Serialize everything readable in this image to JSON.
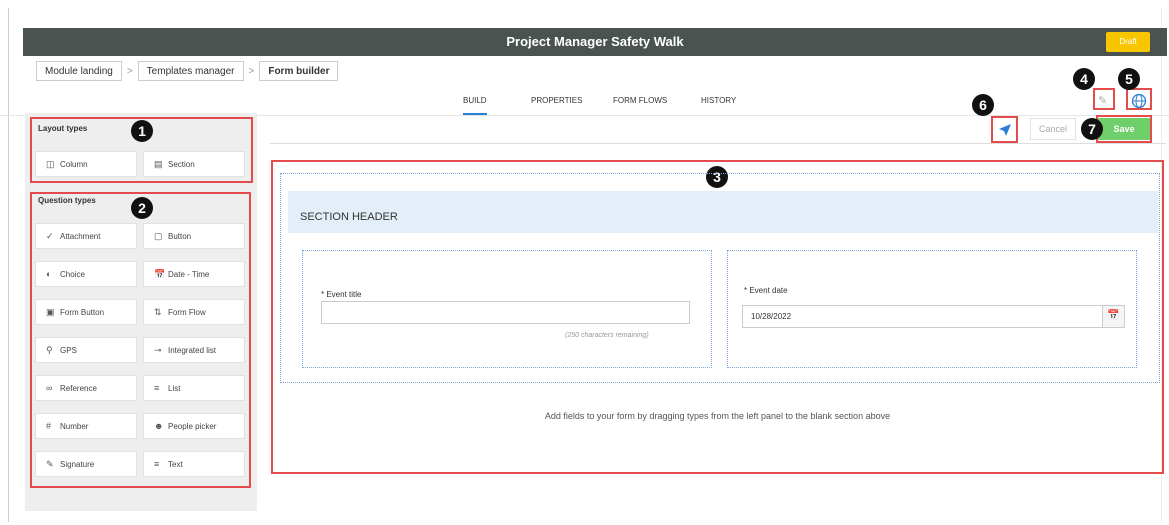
{
  "header": {
    "title": "Project Manager Safety Walk",
    "status_badge": "Draft"
  },
  "breadcrumbs": [
    "Module landing",
    "Templates manager",
    "Form builder"
  ],
  "tabs": [
    "BUILD",
    "PROPERTIES",
    "FORM FLOWS",
    "HISTORY"
  ],
  "toolbar": {
    "cancel_label": "Cancel",
    "save_label": "Save"
  },
  "sidebar": {
    "layout_title": "Layout types",
    "layout_items": [
      {
        "label": "Column",
        "icon": "column-icon"
      },
      {
        "label": "Section",
        "icon": "section-icon"
      }
    ],
    "question_title": "Question types",
    "question_items": [
      {
        "label": "Attachment",
        "icon": "attachment-icon"
      },
      {
        "label": "Button",
        "icon": "button-icon"
      },
      {
        "label": "Choice",
        "icon": "choice-icon"
      },
      {
        "label": "Date - Time",
        "icon": "date-time-icon"
      },
      {
        "label": "Form Button",
        "icon": "form-button-icon"
      },
      {
        "label": "Form Flow",
        "icon": "form-flow-icon"
      },
      {
        "label": "GPS",
        "icon": "gps-icon"
      },
      {
        "label": "Integrated list",
        "icon": "integrated-list-icon"
      },
      {
        "label": "Reference",
        "icon": "reference-icon"
      },
      {
        "label": "List",
        "icon": "list-icon"
      },
      {
        "label": "Number",
        "icon": "number-icon"
      },
      {
        "label": "People picker",
        "icon": "people-picker-icon"
      },
      {
        "label": "Signature",
        "icon": "signature-icon"
      },
      {
        "label": "Text",
        "icon": "text-icon"
      }
    ]
  },
  "callouts": [
    "1",
    "2",
    "3",
    "4",
    "5",
    "6",
    "7"
  ],
  "form": {
    "section_header": "SECTION HEADER",
    "event_title_label": "* Event title",
    "event_title_value": "",
    "event_title_hint": "(250 characters remaining)",
    "event_date_label": "* Event date",
    "event_date_value": "10/28/2022"
  },
  "empty_message": "Add fields to your form by dragging types from the left panel to the blank section above",
  "colors": {
    "titlebar": "#4a5350",
    "draft": "#f7c600",
    "save": "#6fcf6a",
    "callout_box": "#e24c4c",
    "accent": "#2a7fd6"
  }
}
